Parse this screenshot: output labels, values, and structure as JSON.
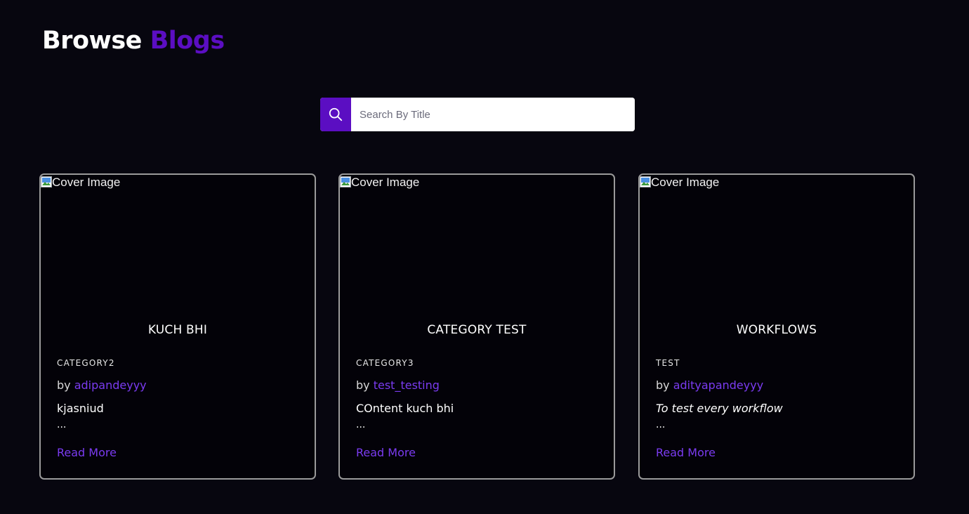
{
  "header": {
    "title_prefix": "Browse",
    "title_accent": "Blogs"
  },
  "search": {
    "placeholder": "Search By Title",
    "value": "",
    "icon": "search-icon"
  },
  "colors": {
    "accent": "#5b0ec2",
    "link": "#7a3bf0",
    "background": "#07060f",
    "card_border": "#9a9a9a"
  },
  "cards": [
    {
      "cover_alt": "Cover Image",
      "title": "KUCH BHI",
      "category": "CATEGORY2",
      "by_label": "by",
      "author": "adipandeyyy",
      "excerpt": "kjasniud",
      "ellipsis": "...",
      "read_more": "Read More"
    },
    {
      "cover_alt": "Cover Image",
      "title": "CATEGORY TEST",
      "category": "CATEGORY3",
      "by_label": "by",
      "author": "test_testing",
      "excerpt": "COntent kuch bhi",
      "ellipsis": "...",
      "read_more": "Read More"
    },
    {
      "cover_alt": "Cover Image",
      "title": "WORKFLOWS",
      "category": "TEST",
      "by_label": "by",
      "author": "adityapandeyyy",
      "excerpt": "To test every workflow",
      "ellipsis": "...",
      "read_more": "Read More"
    }
  ]
}
